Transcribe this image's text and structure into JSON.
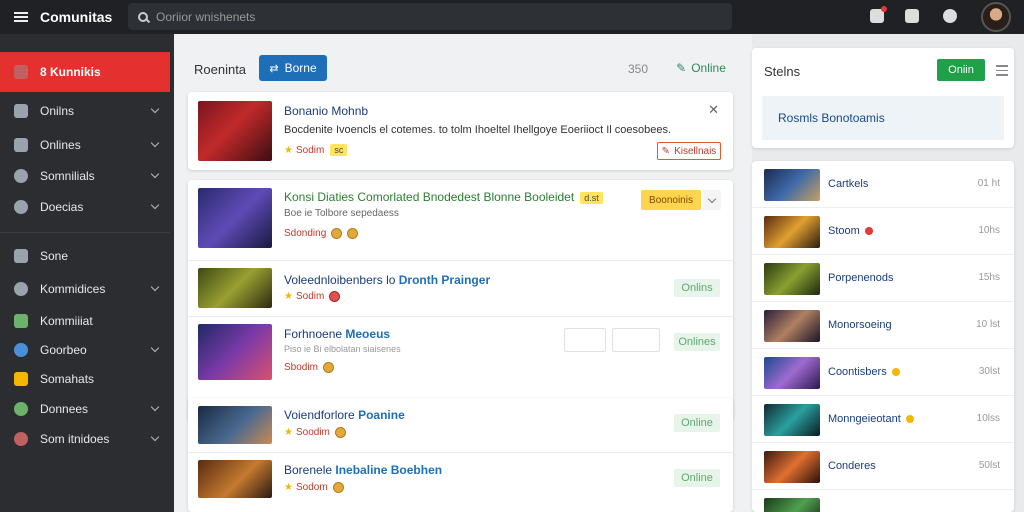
{
  "app": {
    "title": "Comunitas",
    "search_placeholder": "Ooriior wnishenets"
  },
  "sidebar": {
    "active": {
      "label": "8 Kunnikis"
    },
    "items": [
      {
        "label": "Onilns",
        "chevron": true
      },
      {
        "label": "Onlines",
        "chevron": true
      },
      {
        "label": "Somnilials",
        "chevron": true
      },
      {
        "label": "Doecias",
        "chevron": true
      },
      {
        "label": "Sone",
        "chevron": false
      },
      {
        "label": "Kommidices",
        "chevron": true
      },
      {
        "label": "Kommiiiat",
        "chevron": false
      },
      {
        "label": "Goorbeo",
        "chevron": true
      },
      {
        "label": "Somahats",
        "chevron": false
      },
      {
        "label": "Donnees",
        "chevron": true
      },
      {
        "label": "Som itnidoes",
        "chevron": true
      }
    ]
  },
  "toolbar": {
    "title": "Roeninta",
    "primary_button": "Borne",
    "count": "350",
    "online_link": "Online"
  },
  "feed": {
    "featured": {
      "title": "Bonanio Mohnb",
      "description": "Bocdenite Ivoencls el cotemes. to tolm Ihoeltel Ihellgoye Eoeriioct Il coesobees.",
      "meta": "Sodim",
      "tag": "sc",
      "action": "Kisellnais"
    },
    "group": {
      "title": "Konsi Diaties Comorlated Bnodedest Blonne Booleidet",
      "badge": "d.st",
      "subtitle": "Boe ie Tolbore sepedaess",
      "meta": "Sdonding",
      "action": "Boonoinis"
    },
    "rows": [
      {
        "title": "Voleednloibenbers lo",
        "accent": "Dronth Prainger",
        "meta": "Sodim",
        "sub": "",
        "action": "Onlins"
      },
      {
        "title": "Forhnoene",
        "accent": "Meoeus",
        "meta": "Sbodim",
        "sub": "Piso ie Bi elbolatan siaisenes",
        "action": "Onlines"
      }
    ],
    "rows2": [
      {
        "title": "Voiendforlore",
        "accent": "Poanine",
        "meta": "Soodim",
        "action": "Online"
      },
      {
        "title": "Borenele",
        "accent": "Inebaline Boebhen",
        "meta": "Sodom",
        "action": "Online"
      }
    ]
  },
  "right": {
    "header": {
      "title": "Stelns",
      "button": "Oniin"
    },
    "highlight": "Rosmls Bonotoamis",
    "list": [
      {
        "name": "Cartkels",
        "time": "01 ht",
        "dot": ""
      },
      {
        "name": "Stoom",
        "time": "10hs",
        "dot": "#e53935"
      },
      {
        "name": "Porpenenods",
        "time": "15hs",
        "dot": ""
      },
      {
        "name": "Monorsoeing",
        "time": "10 lst",
        "dot": ""
      },
      {
        "name": "Coontisbers",
        "time": "30lst",
        "dot": "#f5b800"
      },
      {
        "name": "Monngeieotant",
        "time": "10lss",
        "dot": "#f5b800"
      },
      {
        "name": "Conderes",
        "time": "50lst",
        "dot": ""
      },
      {
        "name": "",
        "time": "",
        "dot": ""
      }
    ]
  }
}
